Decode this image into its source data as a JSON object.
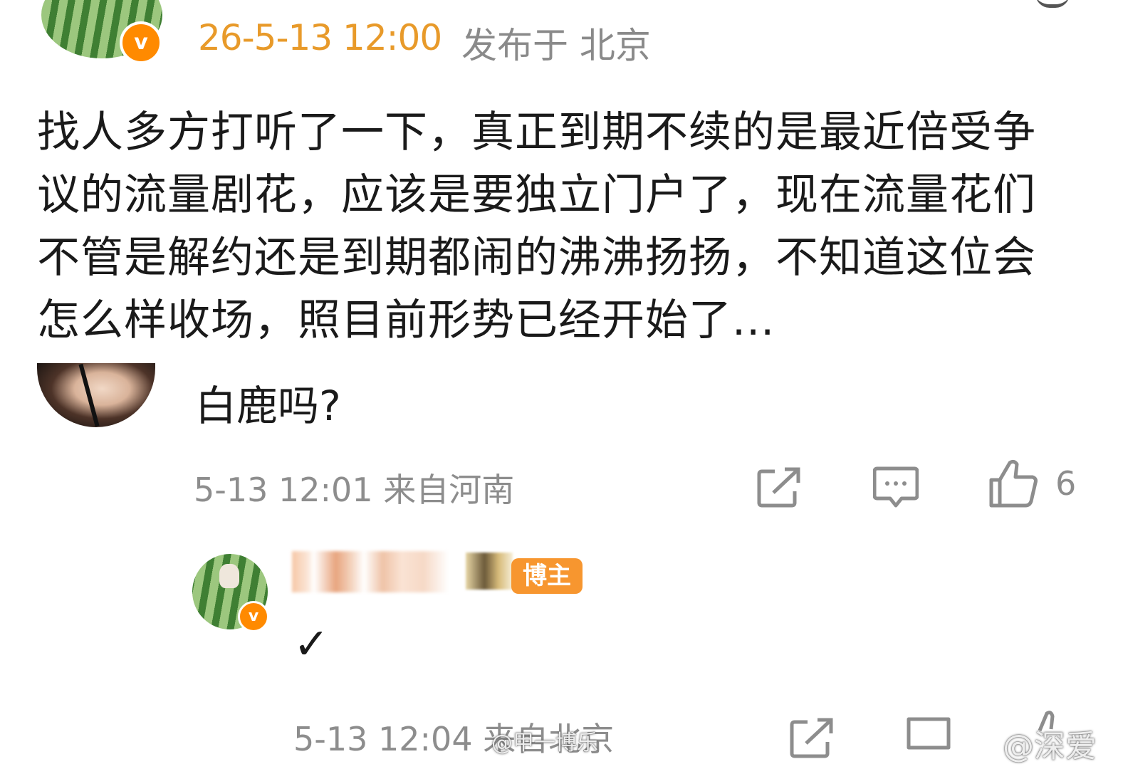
{
  "post": {
    "time": "26-5-13 12:00",
    "location": "发布于 北京",
    "verified_mark": "v",
    "body": "找人多方打听了一下，真正到期不续的是最近倍受争议的流量剧花，应该是要独立门户了，现在流量花们不管是解约还是到期都闹的沸沸扬扬，不知道这位会怎么样收场，照目前形势已经开始了..."
  },
  "comment": {
    "text": "白鹿吗?",
    "meta": "5-13 12:01 来自河南",
    "like_count": "6"
  },
  "reply": {
    "verified_mark": "v",
    "badge": "博主",
    "text": "✓",
    "meta": "5-13 12:04 来自北京"
  },
  "watermark": {
    "left": "@甲一博乐",
    "right": "@深爱"
  },
  "colors": {
    "time_orange": "#e89a2a",
    "meta_gray": "#8d8d8d",
    "badge_orange": "#f7962f",
    "verified_orange": "#ff8a00"
  },
  "icons": [
    "share-icon",
    "comment-icon",
    "like-icon",
    "verified-icon"
  ]
}
